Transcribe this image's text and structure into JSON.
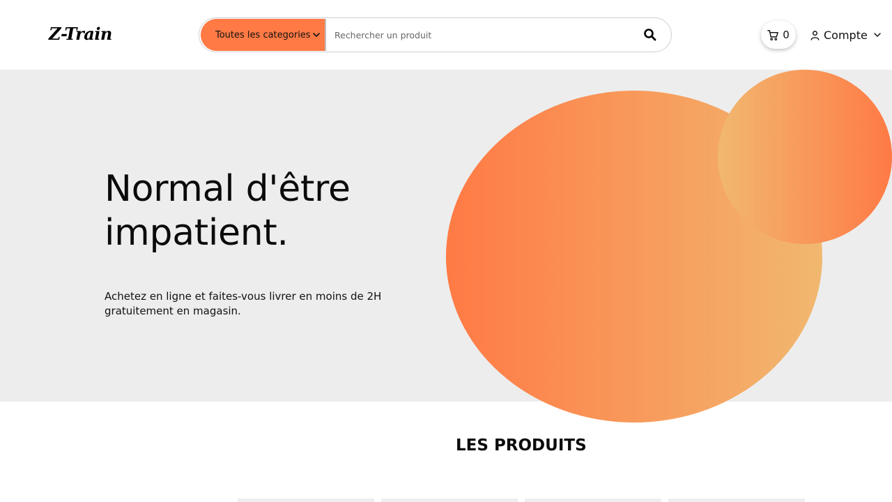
{
  "header": {
    "logo": "Z-Train",
    "search": {
      "category_label": "Toutes les categories",
      "placeholder": "Rechercher un produit"
    },
    "cart": {
      "count": "0"
    },
    "account": {
      "label": "Compte"
    }
  },
  "hero": {
    "title_line1": "Normal d'être",
    "title_line2": "impatient.",
    "subtitle_line1": "Achetez en ligne et faites-vous livrer en moins de 2H",
    "subtitle_line2": "gratuitement en magasin."
  },
  "products": {
    "title": "LES PRODUITS"
  },
  "colors": {
    "accent": "#ff7a45",
    "accent_light": "#f1b870",
    "hero_bg": "#ededed"
  }
}
